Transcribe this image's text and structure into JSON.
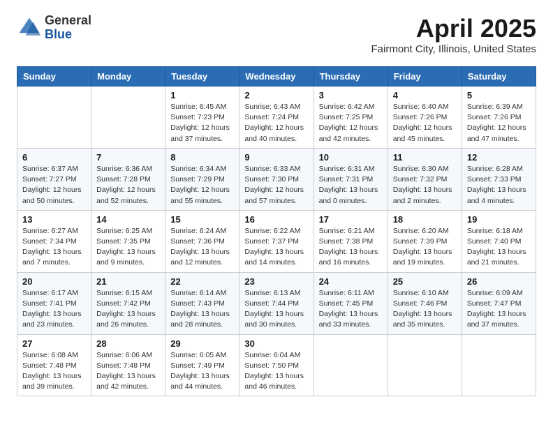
{
  "logo": {
    "general": "General",
    "blue": "Blue"
  },
  "title": "April 2025",
  "subtitle": "Fairmont City, Illinois, United States",
  "days_of_week": [
    "Sunday",
    "Monday",
    "Tuesday",
    "Wednesday",
    "Thursday",
    "Friday",
    "Saturday"
  ],
  "weeks": [
    [
      {
        "day": "",
        "info": ""
      },
      {
        "day": "",
        "info": ""
      },
      {
        "day": "1",
        "info": "Sunrise: 6:45 AM\nSunset: 7:23 PM\nDaylight: 12 hours\nand 37 minutes."
      },
      {
        "day": "2",
        "info": "Sunrise: 6:43 AM\nSunset: 7:24 PM\nDaylight: 12 hours\nand 40 minutes."
      },
      {
        "day": "3",
        "info": "Sunrise: 6:42 AM\nSunset: 7:25 PM\nDaylight: 12 hours\nand 42 minutes."
      },
      {
        "day": "4",
        "info": "Sunrise: 6:40 AM\nSunset: 7:26 PM\nDaylight: 12 hours\nand 45 minutes."
      },
      {
        "day": "5",
        "info": "Sunrise: 6:39 AM\nSunset: 7:26 PM\nDaylight: 12 hours\nand 47 minutes."
      }
    ],
    [
      {
        "day": "6",
        "info": "Sunrise: 6:37 AM\nSunset: 7:27 PM\nDaylight: 12 hours\nand 50 minutes."
      },
      {
        "day": "7",
        "info": "Sunrise: 6:36 AM\nSunset: 7:28 PM\nDaylight: 12 hours\nand 52 minutes."
      },
      {
        "day": "8",
        "info": "Sunrise: 6:34 AM\nSunset: 7:29 PM\nDaylight: 12 hours\nand 55 minutes."
      },
      {
        "day": "9",
        "info": "Sunrise: 6:33 AM\nSunset: 7:30 PM\nDaylight: 12 hours\nand 57 minutes."
      },
      {
        "day": "10",
        "info": "Sunrise: 6:31 AM\nSunset: 7:31 PM\nDaylight: 13 hours\nand 0 minutes."
      },
      {
        "day": "11",
        "info": "Sunrise: 6:30 AM\nSunset: 7:32 PM\nDaylight: 13 hours\nand 2 minutes."
      },
      {
        "day": "12",
        "info": "Sunrise: 6:28 AM\nSunset: 7:33 PM\nDaylight: 13 hours\nand 4 minutes."
      }
    ],
    [
      {
        "day": "13",
        "info": "Sunrise: 6:27 AM\nSunset: 7:34 PM\nDaylight: 13 hours\nand 7 minutes."
      },
      {
        "day": "14",
        "info": "Sunrise: 6:25 AM\nSunset: 7:35 PM\nDaylight: 13 hours\nand 9 minutes."
      },
      {
        "day": "15",
        "info": "Sunrise: 6:24 AM\nSunset: 7:36 PM\nDaylight: 13 hours\nand 12 minutes."
      },
      {
        "day": "16",
        "info": "Sunrise: 6:22 AM\nSunset: 7:37 PM\nDaylight: 13 hours\nand 14 minutes."
      },
      {
        "day": "17",
        "info": "Sunrise: 6:21 AM\nSunset: 7:38 PM\nDaylight: 13 hours\nand 16 minutes."
      },
      {
        "day": "18",
        "info": "Sunrise: 6:20 AM\nSunset: 7:39 PM\nDaylight: 13 hours\nand 19 minutes."
      },
      {
        "day": "19",
        "info": "Sunrise: 6:18 AM\nSunset: 7:40 PM\nDaylight: 13 hours\nand 21 minutes."
      }
    ],
    [
      {
        "day": "20",
        "info": "Sunrise: 6:17 AM\nSunset: 7:41 PM\nDaylight: 13 hours\nand 23 minutes."
      },
      {
        "day": "21",
        "info": "Sunrise: 6:15 AM\nSunset: 7:42 PM\nDaylight: 13 hours\nand 26 minutes."
      },
      {
        "day": "22",
        "info": "Sunrise: 6:14 AM\nSunset: 7:43 PM\nDaylight: 13 hours\nand 28 minutes."
      },
      {
        "day": "23",
        "info": "Sunrise: 6:13 AM\nSunset: 7:44 PM\nDaylight: 13 hours\nand 30 minutes."
      },
      {
        "day": "24",
        "info": "Sunrise: 6:11 AM\nSunset: 7:45 PM\nDaylight: 13 hours\nand 33 minutes."
      },
      {
        "day": "25",
        "info": "Sunrise: 6:10 AM\nSunset: 7:46 PM\nDaylight: 13 hours\nand 35 minutes."
      },
      {
        "day": "26",
        "info": "Sunrise: 6:09 AM\nSunset: 7:47 PM\nDaylight: 13 hours\nand 37 minutes."
      }
    ],
    [
      {
        "day": "27",
        "info": "Sunrise: 6:08 AM\nSunset: 7:48 PM\nDaylight: 13 hours\nand 39 minutes."
      },
      {
        "day": "28",
        "info": "Sunrise: 6:06 AM\nSunset: 7:48 PM\nDaylight: 13 hours\nand 42 minutes."
      },
      {
        "day": "29",
        "info": "Sunrise: 6:05 AM\nSunset: 7:49 PM\nDaylight: 13 hours\nand 44 minutes."
      },
      {
        "day": "30",
        "info": "Sunrise: 6:04 AM\nSunset: 7:50 PM\nDaylight: 13 hours\nand 46 minutes."
      },
      {
        "day": "",
        "info": ""
      },
      {
        "day": "",
        "info": ""
      },
      {
        "day": "",
        "info": ""
      }
    ]
  ]
}
